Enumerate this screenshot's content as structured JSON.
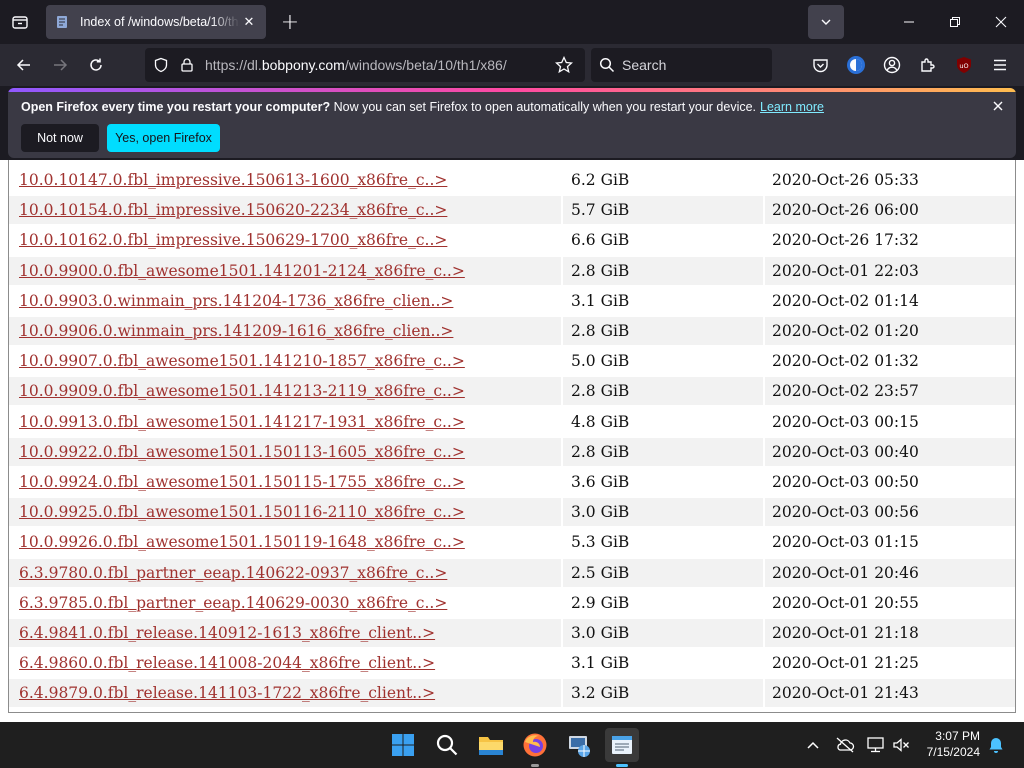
{
  "tab": {
    "title": "Index of /windows/beta/10/th1/x86/"
  },
  "address": {
    "prefix": "https://dl.",
    "host": "bobpony.com",
    "path": "/windows/beta/10/th1/x86/"
  },
  "search": {
    "placeholder": "Search"
  },
  "notification": {
    "bold": "Open Firefox every time you restart your computer?",
    "message": " Now you can set Firefox to open automatically when you restart your device.",
    "link": "Learn more",
    "not_now": "Not now",
    "yes": "Yes, open Firefox"
  },
  "colors": {
    "accent": "#00ddff",
    "link": "#a0322f",
    "notif_link": "#80ebff"
  },
  "listing": {
    "rows": [
      {
        "name": "10.0.10147.0.fbl_impressive.150613-1600_x86fre_c..>",
        "size": "6.2 GiB",
        "date": "2020-Oct-26 05:33"
      },
      {
        "name": "10.0.10154.0.fbl_impressive.150620-2234_x86fre_c..>",
        "size": "5.7 GiB",
        "date": "2020-Oct-26 06:00"
      },
      {
        "name": "10.0.10162.0.fbl_impressive.150629-1700_x86fre_c..>",
        "size": "6.6 GiB",
        "date": "2020-Oct-26 17:32"
      },
      {
        "name": "10.0.9900.0.fbl_awesome1501.141201-2124_x86fre_c..>",
        "size": "2.8 GiB",
        "date": "2020-Oct-01 22:03"
      },
      {
        "name": "10.0.9903.0.winmain_prs.141204-1736_x86fre_clien..>",
        "size": "3.1 GiB",
        "date": "2020-Oct-02 01:14"
      },
      {
        "name": "10.0.9906.0.winmain_prs.141209-1616_x86fre_clien..>",
        "size": "2.8 GiB",
        "date": "2020-Oct-02 01:20"
      },
      {
        "name": "10.0.9907.0.fbl_awesome1501.141210-1857_x86fre_c..>",
        "size": "5.0 GiB",
        "date": "2020-Oct-02 01:32"
      },
      {
        "name": "10.0.9909.0.fbl_awesome1501.141213-2119_x86fre_c..>",
        "size": "2.8 GiB",
        "date": "2020-Oct-02 23:57"
      },
      {
        "name": "10.0.9913.0.fbl_awesome1501.141217-1931_x86fre_c..>",
        "size": "4.8 GiB",
        "date": "2020-Oct-03 00:15"
      },
      {
        "name": "10.0.9922.0.fbl_awesome1501.150113-1605_x86fre_c..>",
        "size": "2.8 GiB",
        "date": "2020-Oct-03 00:40"
      },
      {
        "name": "10.0.9924.0.fbl_awesome1501.150115-1755_x86fre_c..>",
        "size": "3.6 GiB",
        "date": "2020-Oct-03 00:50"
      },
      {
        "name": "10.0.9925.0.fbl_awesome1501.150116-2110_x86fre_c..>",
        "size": "3.0 GiB",
        "date": "2020-Oct-03 00:56"
      },
      {
        "name": "10.0.9926.0.fbl_awesome1501.150119-1648_x86fre_c..>",
        "size": "5.3 GiB",
        "date": "2020-Oct-03 01:15"
      },
      {
        "name": "6.3.9780.0.fbl_partner_eeap.140622-0937_x86fre_c..>",
        "size": "2.5 GiB",
        "date": "2020-Oct-01 20:46"
      },
      {
        "name": "6.3.9785.0.fbl_partner_eeap.140629-0030_x86fre_c..>",
        "size": "2.9 GiB",
        "date": "2020-Oct-01 20:55"
      },
      {
        "name": "6.4.9841.0.fbl_release.140912-1613_x86fre_client..>",
        "size": "3.0 GiB",
        "date": "2020-Oct-01 21:18"
      },
      {
        "name": "6.4.9860.0.fbl_release.141008-2044_x86fre_client..>",
        "size": "3.1 GiB",
        "date": "2020-Oct-01 21:25"
      },
      {
        "name": "6.4.9879.0.fbl_release.141103-1722_x86fre_client..>",
        "size": "3.2 GiB",
        "date": "2020-Oct-01 21:43"
      }
    ]
  },
  "taskbar": {
    "time": "3:07 PM",
    "date": "7/15/2024",
    "apps": [
      "windows-start-icon",
      "search-icon",
      "file-explorer-icon",
      "firefox-icon",
      "network-app-icon",
      "notepad-icon"
    ]
  }
}
